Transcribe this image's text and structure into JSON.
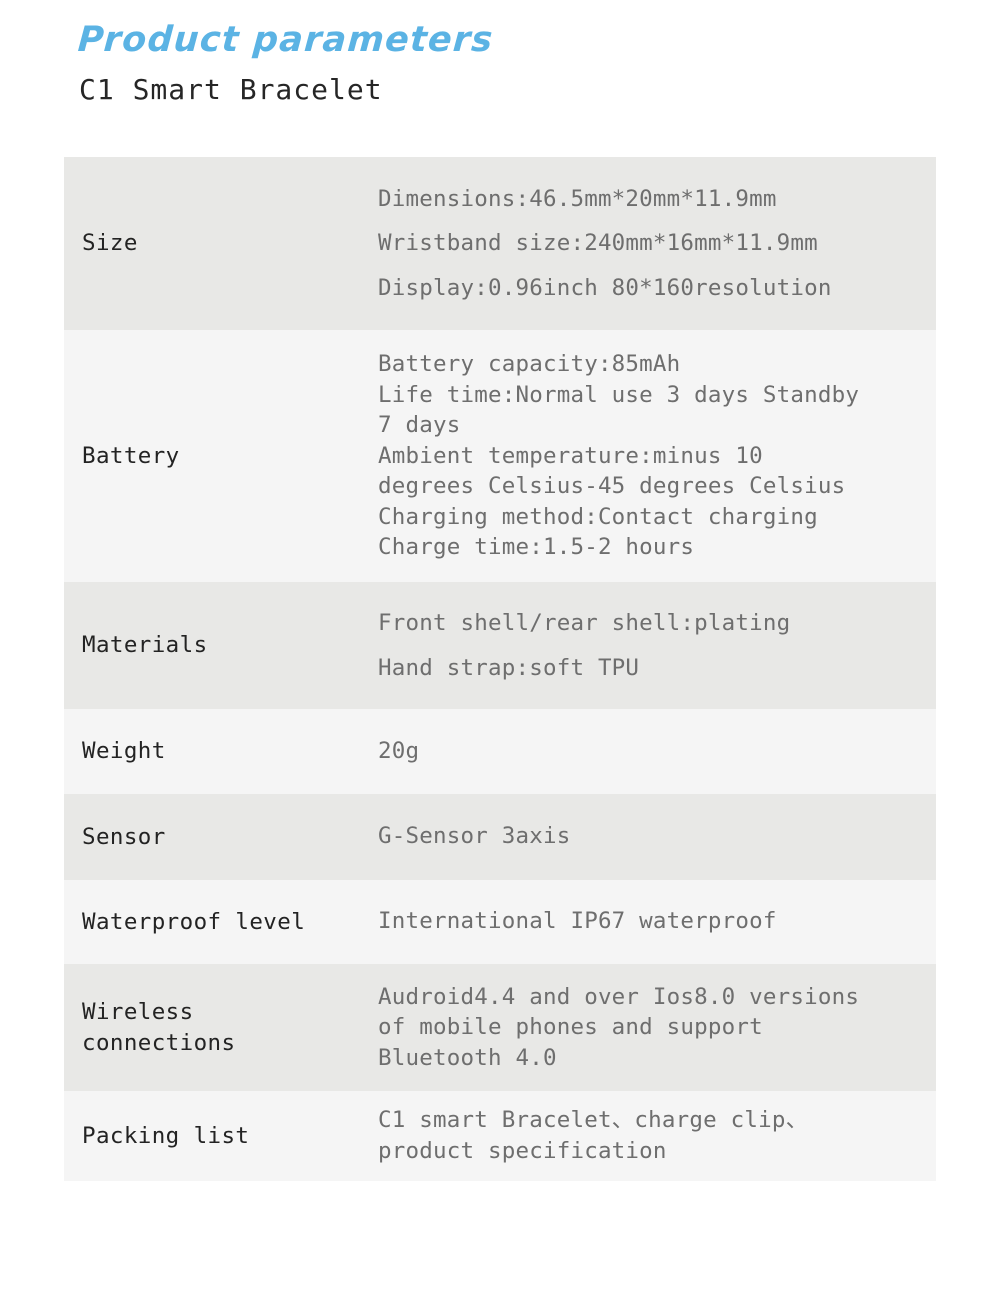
{
  "header": {
    "title": "Product parameters",
    "subtitle": "C1 Smart Bracelet",
    "title_color": "#5bb3e4",
    "subtitle_color": "#262626"
  },
  "colors": {
    "row_shade_dark": "#e8e8e6",
    "row_shade_light": "#f5f5f5",
    "label_text": "#232323",
    "value_text": "#6e6e6e"
  },
  "table": {
    "rows": [
      {
        "label": "Size",
        "label_lines": [
          "Size"
        ],
        "values": [
          "Dimensions:46.5mm*20mm*11.9mm",
          "Wristband size:240mm*16mm*11.9mm",
          "Display:0.96inch 80*160resolution"
        ]
      },
      {
        "label": "Battery",
        "label_lines": [
          "Battery"
        ],
        "values": [
          "Battery capacity:85mAh",
          "Life time:Normal use 3 days Standby",
          "7 days",
          "Ambient temperature:minus 10",
          "degrees Celsius-45 degrees Celsius",
          "Charging method:Contact charging",
          "Charge time:1.5-2 hours"
        ]
      },
      {
        "label": "Materials",
        "label_lines": [
          "Materials"
        ],
        "values": [
          "Front shell/rear shell:plating",
          "Hand strap:soft TPU"
        ]
      },
      {
        "label": "Weight",
        "label_lines": [
          "Weight"
        ],
        "values": [
          "20g"
        ]
      },
      {
        "label": "Sensor",
        "label_lines": [
          "Sensor"
        ],
        "values": [
          "G-Sensor 3axis"
        ]
      },
      {
        "label": "Waterproof level",
        "label_lines": [
          "Waterproof level"
        ],
        "values": [
          "International IP67 waterproof"
        ]
      },
      {
        "label": "Wireless connections",
        "label_lines": [
          "Wireless",
          "connections"
        ],
        "values": [
          "Audroid4.4 and over Ios8.0 versions",
          "of mobile phones and support",
          "Bluetooth 4.0"
        ]
      },
      {
        "label": "Packing list",
        "label_lines": [
          "Packing list"
        ],
        "values": [
          "C1 smart Bracelet、charge clip、",
          "product specification"
        ]
      }
    ]
  }
}
